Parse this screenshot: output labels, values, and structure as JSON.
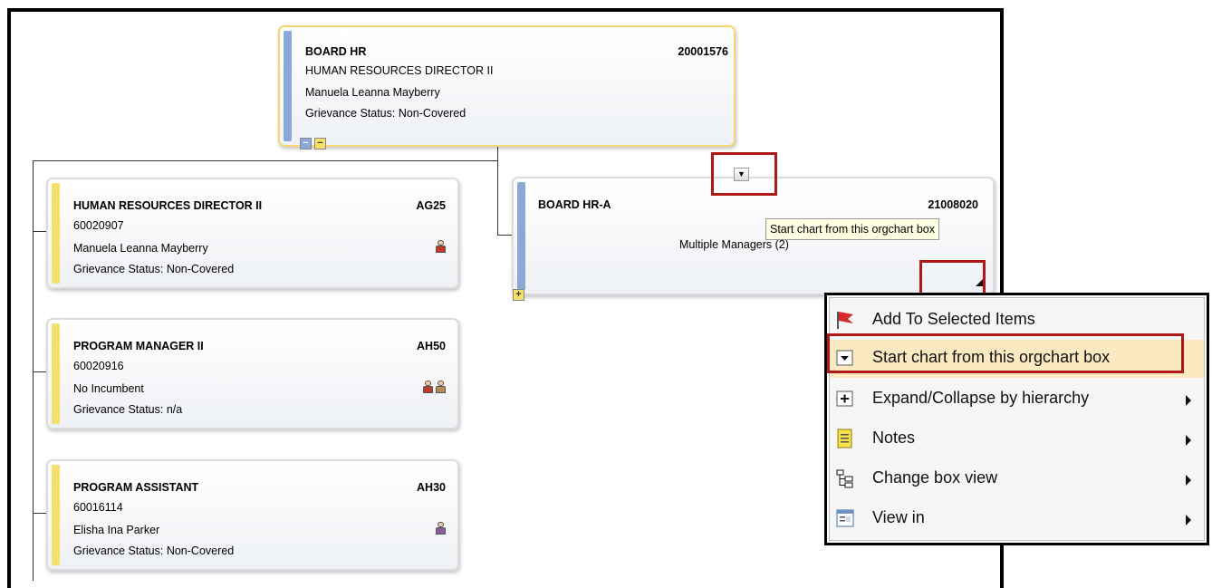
{
  "nodes": {
    "root": {
      "title": "BOARD HR",
      "code": "20001576",
      "line2": "HUMAN RESOURCES DIRECTOR II",
      "line3": "Manuela Leanna Mayberry",
      "line4": "Grievance Status: Non-Covered",
      "ctrl_collapse": "−",
      "ctrl_expand": "−"
    },
    "hr_director": {
      "title": "HUMAN RESOURCES DIRECTOR II",
      "code": "AG25",
      "line2": "60020907",
      "line3": "Manuela Leanna Mayberry",
      "line4": "Grievance Status: Non-Covered"
    },
    "board_hr_a": {
      "title": "BOARD HR-A",
      "code": "21008020",
      "line3": "Multiple Managers (2)",
      "ctrl_expand": "+"
    },
    "program_manager": {
      "title": "PROGRAM MANAGER II",
      "code": "AH50",
      "line2": "60020916",
      "line3": "No Incumbent",
      "line4": "Grievance Status: n/a"
    },
    "program_assistant": {
      "title": "PROGRAM ASSISTANT",
      "code": "AH30",
      "line2": "60016114",
      "line3": "Elisha Ina Parker",
      "line4": "Grievance Status: Non-Covered"
    }
  },
  "start_button_glyph": "▼",
  "tooltip": "Start chart from this orgchart box",
  "context_menu": {
    "items": [
      {
        "label": "Add To Selected Items",
        "icon": "red-flag-icon"
      },
      {
        "label": "Start chart from this orgchart box",
        "icon": "dropdown-box-icon",
        "highlighted": true
      },
      {
        "label": "Expand/Collapse by hierarchy",
        "icon": "plus-box-icon",
        "submenu": true
      },
      {
        "label": "Notes",
        "icon": "notes-icon",
        "submenu": true
      },
      {
        "label": "Change box view",
        "icon": "hierarchy-tree-icon",
        "submenu": true
      },
      {
        "label": "View in",
        "icon": "form-view-icon",
        "submenu": true
      }
    ]
  },
  "colors": {
    "annotation_red": "#b01818",
    "manager_bar": "#8aa9d6",
    "position_bar": "#f6e06b",
    "tooltip_bg": "#ffffe1",
    "menu_highlight": "#fbe9c2"
  }
}
